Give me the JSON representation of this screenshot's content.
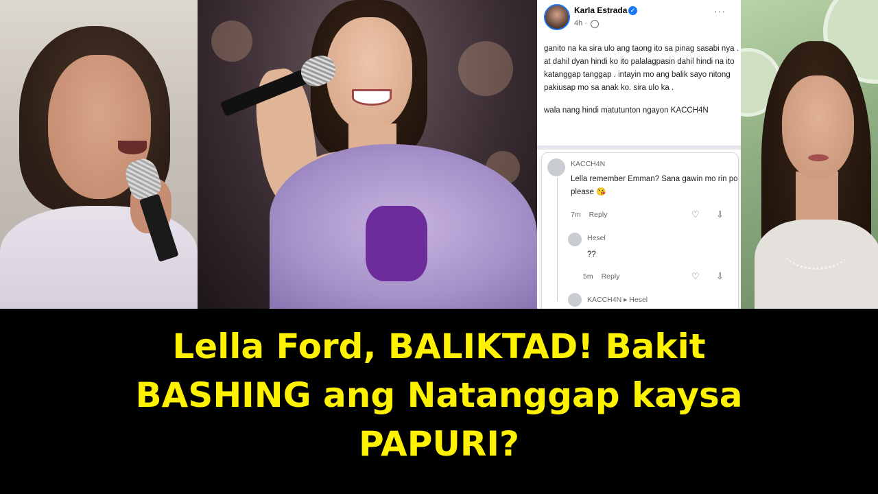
{
  "headline": {
    "line1": "Lella Ford, BALIKTAD! Bakit",
    "line2": "BASHING ang Natanggap kaysa",
    "line3": "PAPURI?",
    "color": "#fff200"
  },
  "facebook_post": {
    "author": "Karla Estrada",
    "time": "4h ·",
    "more": "···",
    "lines": [
      "ganito na  ka sira ulo ang taong ito sa pinag sasabi nya .",
      "at dahil dyan hindi ko ito palalagpasin dahil hindi na ito",
      "katanggap tanggap . intayin mo ang balik sayo nitong",
      "pakiusap mo sa anak ko. sira ulo ka ."
    ],
    "last_line": "wala nang hindi matutunton ngayon KACCH4N",
    "comments": [
      {
        "name": "KACCH4N",
        "text_lines": [
          "Lella remember Emman? Sana gawin mo rin po",
          "please 😘"
        ],
        "time": "7m",
        "reply": "Reply"
      },
      {
        "name": "Hesel",
        "text_lines": [
          "??"
        ],
        "time": "5m",
        "reply": "Reply"
      },
      {
        "name": "KACCH4N ▸ Hesel"
      }
    ],
    "accent": "#1877f2"
  }
}
